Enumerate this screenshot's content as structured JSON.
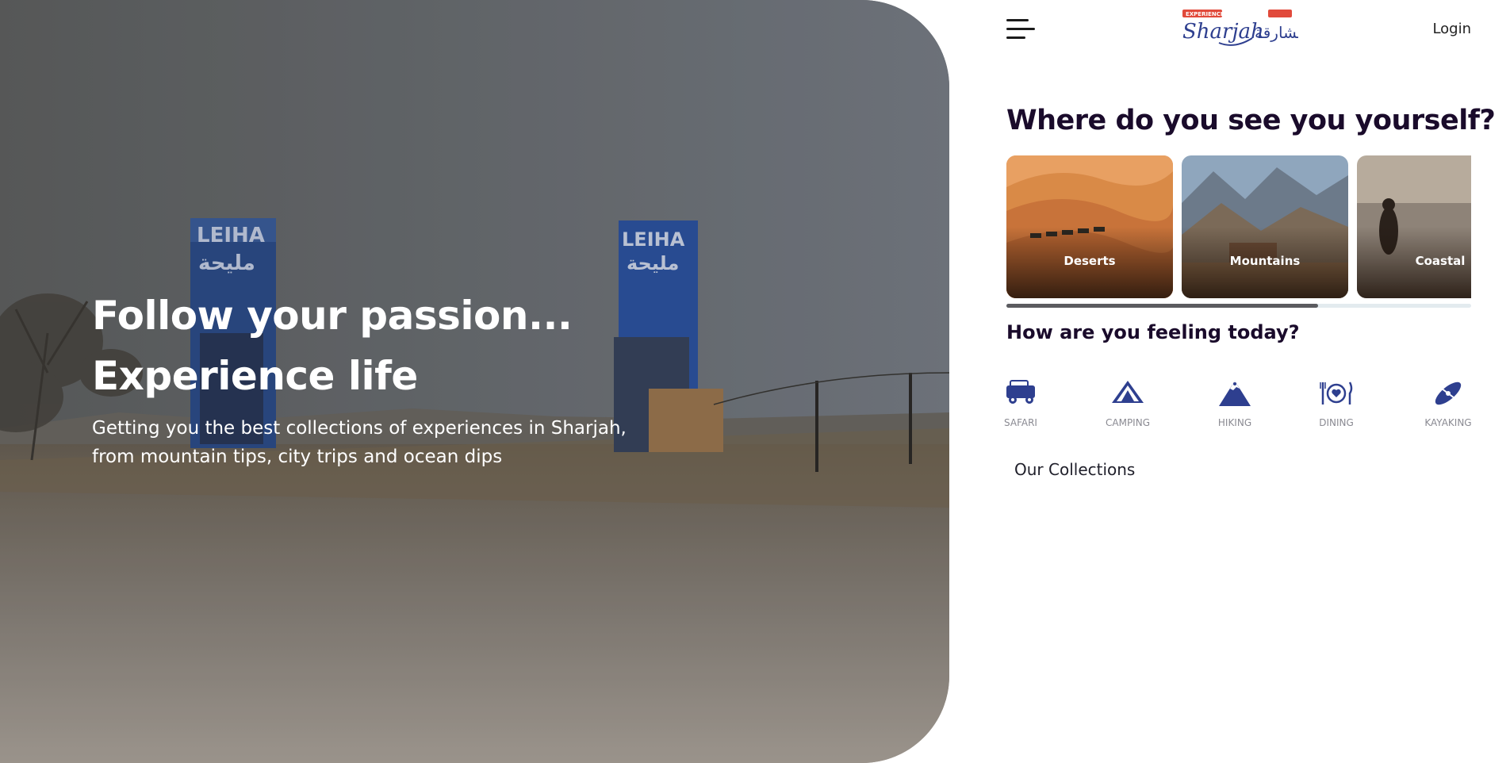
{
  "hero": {
    "title_line1": "Follow your passion...",
    "title_line2": "Experience life",
    "subtitle": "Getting you the best collections of experiences in Sharjah, from mountain tips, city trips and ocean dips",
    "sign_text": "LEIHA",
    "sign_text_ar": "مليحة"
  },
  "header": {
    "logo_small": "EXPERIENCE",
    "logo_en": "Sharjah",
    "logo_ar": "الشارقة",
    "login_label": "Login"
  },
  "destinations": {
    "title": "Where do you see you yourself?",
    "cards": [
      {
        "label": "Deserts"
      },
      {
        "label": "Mountains"
      },
      {
        "label": "Coastal"
      }
    ],
    "scroll_fraction": 0.67
  },
  "feelings": {
    "title": "How are you feeling today?",
    "items": [
      {
        "label": "SAFARI",
        "icon": "safari-jeep-icon"
      },
      {
        "label": "CAMPING",
        "icon": "tent-icon"
      },
      {
        "label": "HIKING",
        "icon": "mountain-icon"
      },
      {
        "label": "DINING",
        "icon": "dining-plate-icon"
      },
      {
        "label": "KAYAKING",
        "icon": "kayak-icon"
      }
    ]
  },
  "collections": {
    "title": "Our Collections"
  },
  "colors": {
    "accent": "#2e3f8f",
    "heading": "#1a0b2b",
    "logo_red": "#e14a3b"
  }
}
